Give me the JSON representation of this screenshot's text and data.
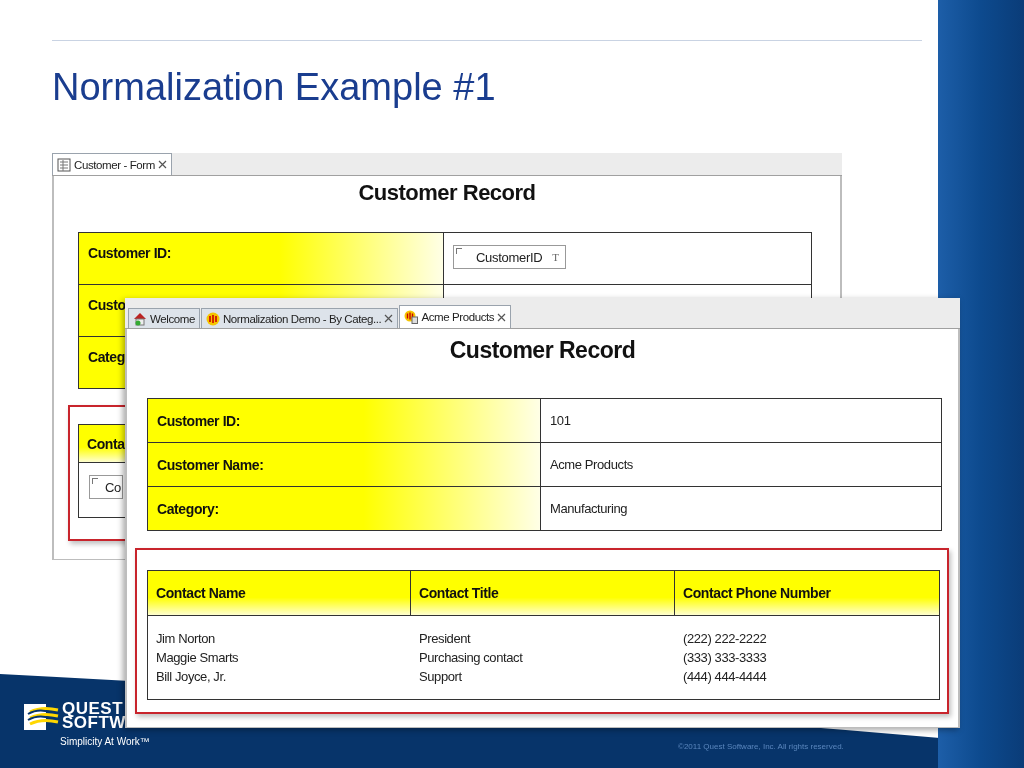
{
  "slide": {
    "title": "Normalization Example #1",
    "footer": "©2011 Quest Software, Inc. All rights reserved.",
    "logo": {
      "line_1": "QUEST",
      "line_2": "SOFTW",
      "tagline": "Simplicity At Work™"
    }
  },
  "back_window": {
    "tabs": [
      {
        "label": "Customer - Form",
        "kind": "form",
        "closable": true,
        "selected": true
      }
    ],
    "heading": "Customer Record",
    "fields": [
      {
        "label": "Customer ID:",
        "value": "CustomerID",
        "marker": "T"
      },
      {
        "label": "Custo"
      },
      {
        "label": "Categ"
      }
    ],
    "contacts": {
      "header": "Conta",
      "field": "Co"
    }
  },
  "front_window": {
    "tabs": [
      {
        "label": "Welcome",
        "kind": "home",
        "closable": false,
        "selected": false
      },
      {
        "label": "Normalization Demo - By Categ...",
        "kind": "db",
        "closable": true,
        "selected": false
      },
      {
        "label": "Acme Products",
        "kind": "db-doc",
        "closable": true,
        "selected": true
      }
    ],
    "heading": "Customer Record",
    "fields": [
      {
        "label": "Customer ID:",
        "value": "101"
      },
      {
        "label": "Customer Name:",
        "value": "Acme Products"
      },
      {
        "label": "Category:",
        "value": "Manufacturing"
      }
    ],
    "contacts": {
      "columns": [
        "Contact Name",
        "Contact Title",
        "Contact Phone Number"
      ],
      "rows": [
        [
          "Jim Norton",
          "President",
          "(222) 222-2222"
        ],
        [
          "Maggie Smarts",
          "Purchasing contact",
          "(333) 333-3333"
        ],
        [
          "Bill Joyce, Jr.",
          "Support",
          "(444) 444-4444"
        ]
      ]
    }
  }
}
